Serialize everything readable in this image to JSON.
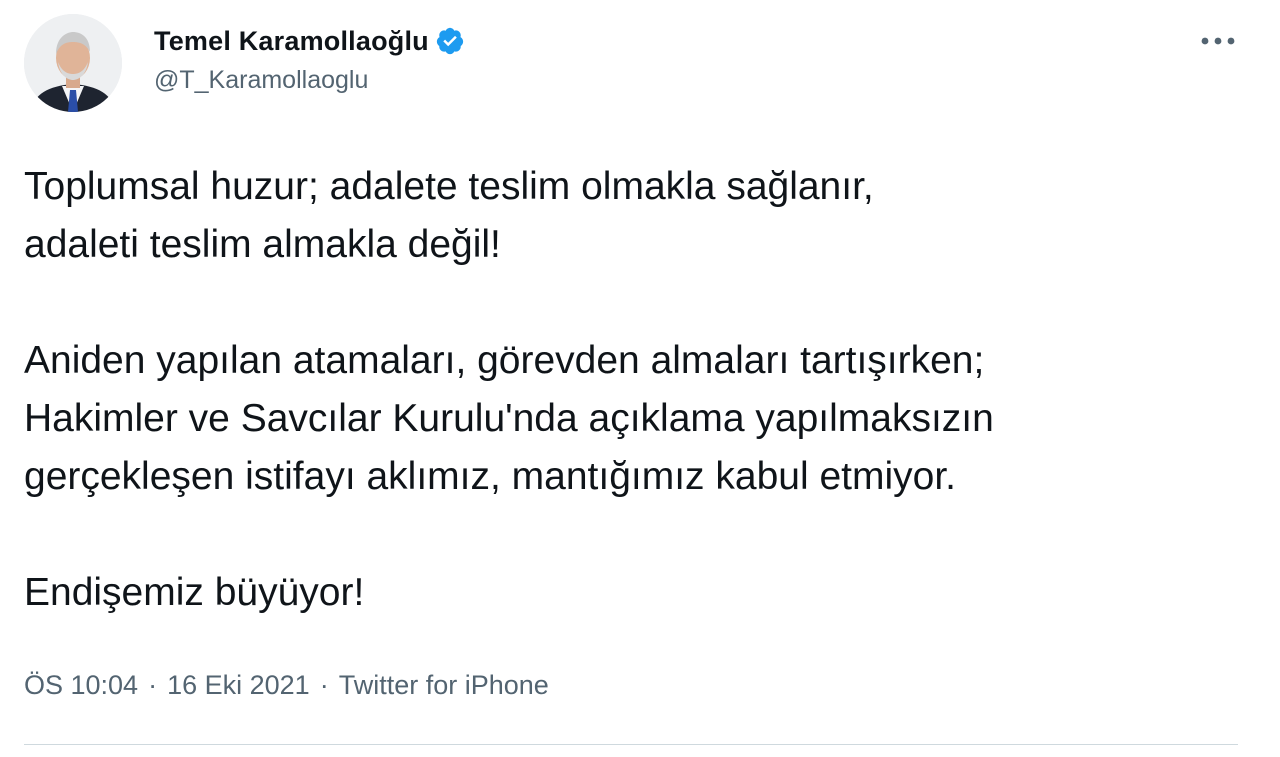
{
  "author": {
    "display_name": "Temel Karamollaoğlu",
    "handle": "@T_Karamollaoglu",
    "verified": true,
    "verified_color": "#1d9bf0",
    "avatar_icon": "profile-photo"
  },
  "more_icon": "ellipsis-icon",
  "tweet": {
    "paragraphs": [
      {
        "lines": [
          "Toplumsal huzur; adalete teslim olmakla sağlanır,",
          "adaleti teslim almakla değil!"
        ]
      },
      {
        "lines": [
          "Aniden yapılan atamaları, görevden almaları tartışırken;",
          "Hakimler ve Savcılar Kurulu'nda açıklama yapılmaksızın",
          "gerçekleşen istifayı aklımız, mantığımız kabul etmiyor."
        ]
      },
      {
        "lines": [
          "Endişemiz büyüyor!"
        ]
      }
    ]
  },
  "meta": {
    "time": "ÖS 10:04",
    "separator": "·",
    "date": "16 Eki 2021",
    "source": "Twitter for iPhone"
  },
  "colors": {
    "text_primary": "#0f1419",
    "text_secondary": "#536471",
    "divider": "#cfd9de"
  }
}
